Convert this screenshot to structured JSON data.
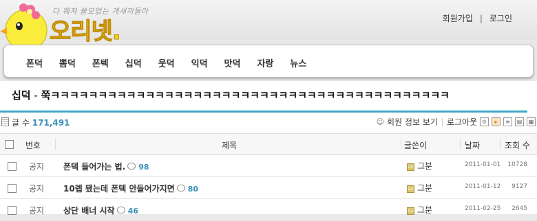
{
  "site": {
    "slogan": "다 뭬져 쓸모없는 개새끼들아",
    "logo_text": "오리넷.",
    "auth": {
      "join": "회원가입",
      "separator": "|",
      "login": "로그인"
    }
  },
  "nav": {
    "items": [
      "폰덕",
      "뽐덕",
      "폰텍",
      "십덕",
      "웃덕",
      "익덕",
      "맛덕",
      "자랑",
      "뉴스"
    ]
  },
  "board": {
    "name": "십덕",
    "dash": " - ",
    "subtitle": "쭉ㅋㅋㅋㅋㅋㅋㅋㅋㅋㅋㅋㅋㅋㅋㅋㅋㅋㅋㅋㅋㅋㅋㅋㅋㅋㅋㅋㅋㅋㅋㅋㅋㅋㅋㅋㅋㅋㅋㅋㅋㅋㅋ",
    "count_label": "글 수",
    "count_value": "171,491",
    "member_info": "회원 정보 보기",
    "logout": "로그아웃"
  },
  "table": {
    "headers": {
      "num": "번호",
      "title": "제목",
      "author": "글쓴이",
      "date": "날짜",
      "views": "조회 수"
    },
    "rows": [
      {
        "num": "공지",
        "title": "폰텍 들어가는 법.",
        "comments": "98",
        "author": "그분",
        "date": "2011-01-01",
        "views": "10728"
      },
      {
        "num": "공지",
        "title": "10렙 됐는데 폰텍 안들어가지면",
        "comments": "80",
        "author": "그분",
        "date": "2011-01-12",
        "views": "9127"
      },
      {
        "num": "공지",
        "title": "상단 배너 시작",
        "comments": "46",
        "author": "그분",
        "date": "2011-02-25",
        "views": "2645"
      }
    ]
  },
  "colors": {
    "accent": "#3ea9c9",
    "link_blue": "#3a8fb7",
    "logo_pink": "#e0457b"
  }
}
